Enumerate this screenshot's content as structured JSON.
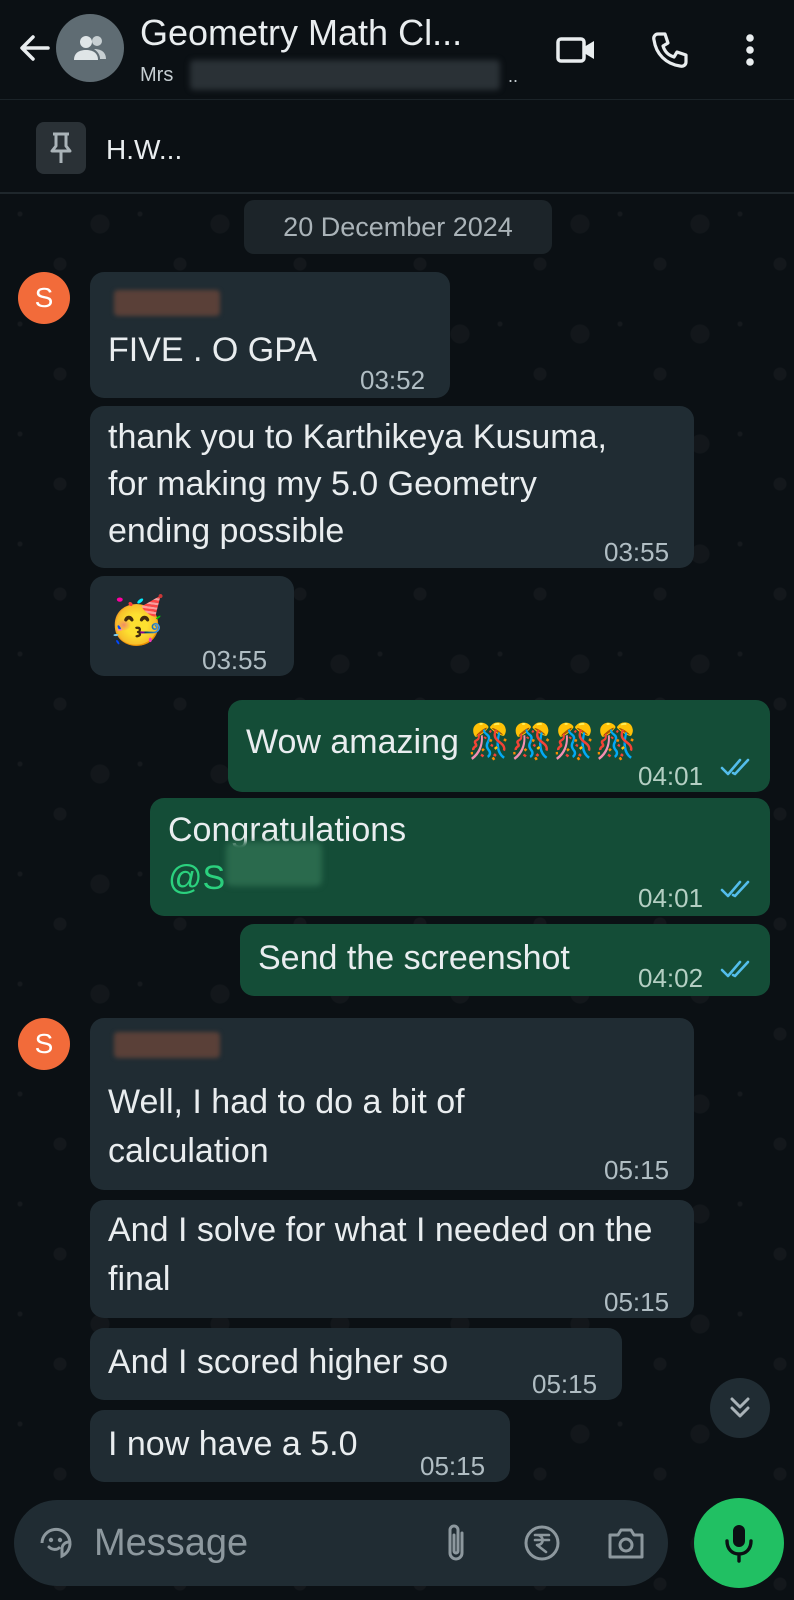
{
  "header": {
    "title": "Geometry Math Cl...",
    "subtitle": "Mrs",
    "subtitle_ellipsis": ".."
  },
  "pinned": {
    "text": "H.W..."
  },
  "date_divider": "20 December 2024",
  "messages": [
    {
      "dir": "in",
      "avatar": "S",
      "text": "FIVE . O GPA",
      "time": "03:52"
    },
    {
      "dir": "in",
      "text": "thank you to Karthikeya Kusuma, for making my 5.0 Geometry ending possible",
      "time": "03:55"
    },
    {
      "dir": "in",
      "text": "🥳",
      "time": "03:55"
    },
    {
      "dir": "out",
      "text": "Wow amazing 🎊🎊🎊🎊",
      "time": "04:01",
      "status": "read"
    },
    {
      "dir": "out",
      "text": "Congratulations",
      "mention": "@S",
      "time": "04:01",
      "status": "read"
    },
    {
      "dir": "out",
      "text": "Send the screenshot",
      "time": "04:02",
      "status": "read"
    },
    {
      "dir": "in",
      "avatar": "S",
      "text": "Well, I had to do a bit of calculation",
      "time": "05:15"
    },
    {
      "dir": "in",
      "text": "And I solve for what I needed on the final",
      "time": "05:15"
    },
    {
      "dir": "in",
      "text": "And I scored higher so",
      "time": "05:15"
    },
    {
      "dir": "in",
      "text": "I now have a 5.0",
      "time": "05:15"
    }
  ],
  "composer": {
    "placeholder": "Message"
  },
  "colors": {
    "background": "#0b1014",
    "incoming_bubble": "#202c33",
    "outgoing_bubble": "#144d37",
    "accent_green": "#21c063",
    "mention_green": "#2bd17e",
    "avatar_orange": "#f26b3a",
    "read_ticks": "#53bdeb"
  },
  "icons": [
    "back-arrow-icon",
    "group-icon",
    "video-call-icon",
    "phone-icon",
    "more-vert-icon",
    "pin-icon",
    "double-check-icon",
    "scroll-down-icon",
    "sticker-icon",
    "attach-icon",
    "rupee-icon",
    "camera-icon",
    "mic-icon"
  ]
}
